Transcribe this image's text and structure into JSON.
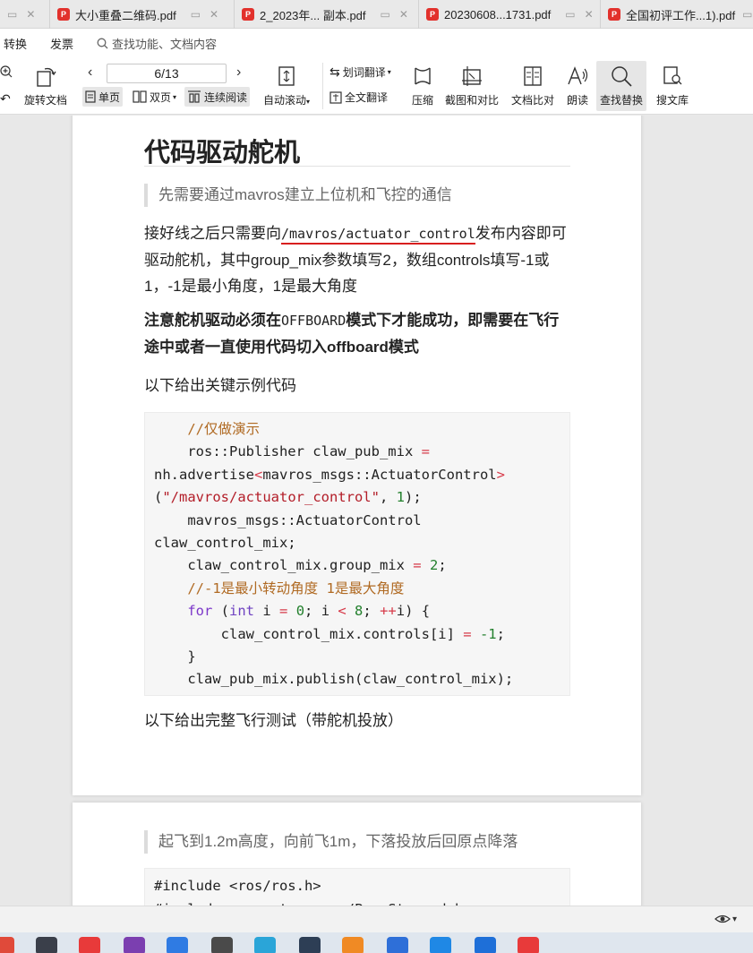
{
  "tabs": [
    {
      "title": ""
    },
    {
      "title": "大小重叠二维码.pdf"
    },
    {
      "title": "2_2023年... 副本.pdf"
    },
    {
      "title": "20230608...1731.pdf"
    },
    {
      "title": "全国初评工作...1).pdf"
    }
  ],
  "menu": {
    "items": [
      "转换",
      "发票"
    ],
    "search_placeholder": "查找功能、文档内容"
  },
  "toolbar": {
    "rotate_label": "旋转文档",
    "page_indicator": "6/13",
    "single_page": "单页",
    "double_page": "双页",
    "continuous": "连续阅读",
    "auto_scroll": "自动滚动",
    "word_translate": "划词翻译",
    "full_translate": "全文翻译",
    "compress": "压缩",
    "screenshot_compare": "截图和对比",
    "doc_compare": "文档比对",
    "read_aloud": "朗读",
    "find_replace": "查找替换",
    "search_library": "搜文库"
  },
  "document": {
    "heading": "代码驱动舵机",
    "quote1": "先需要通过mavros建立上位机和飞控的通信",
    "para1_before": "接好线之后只需要向",
    "para1_code": "/mavros/actuator_control",
    "para1_after": "发布内容即可驱动舵机，其中group_mix参数填写2，数组controls填写-1或1，-1是最小角度，1是最大角度",
    "note_before": "注意舵机驱动必须在",
    "note_code": "OFFBOARD",
    "note_after": "模式下才能成功，即需要在飞行途中或者一直使用代码切入offboard模式",
    "example_intro": "以下给出关键示例代码",
    "code_lines": {
      "l1": "//仅做演示",
      "l2a": "ros::Publisher claw_pub_mix ",
      "l2b": "=",
      "l3a": "nh.advertise",
      "l3b": "<",
      "l3c": "mavros_msgs::ActuatorControl",
      "l3d": ">",
      "l4a": "(",
      "l4b": "\"/mavros/actuator_control\"",
      "l4c": ", ",
      "l4d": "1",
      "l4e": ");",
      "l5": "mavros_msgs::ActuatorControl",
      "l6": "claw_control_mix;",
      "l7a": "claw_control_mix.group_mix ",
      "l7b": "=",
      "l7c": " ",
      "l7d": "2",
      "l7e": ";",
      "l8": "//-1是最小转动角度 1是最大角度",
      "l9a": "for",
      "l9b": " (",
      "l9c": "int",
      "l9d": " i ",
      "l9e": "=",
      "l9f": " ",
      "l9g": "0",
      "l9h": "; i ",
      "l9i": "<",
      "l9j": " ",
      "l9k": "8",
      "l9l": "; ",
      "l9m": "++",
      "l9n": "i) {",
      "l10a": "claw_control_mix.controls[i] ",
      "l10b": "=",
      "l10c": " ",
      "l10d": "-1",
      "l10e": ";",
      "l11": "}",
      "l12": "claw_pub_mix.publish(claw_control_mix);"
    },
    "full_test_intro": "以下给出完整飞行测试（带舵机投放）",
    "quote2": "起飞到1.2m高度，向前飞1m，下落投放后回原点降落",
    "code2_line1": "#include <ros/ros.h>",
    "code2_line2": "#include <geometry_msgs/PoseStamped.h>"
  },
  "colors": {
    "accent_red": "#d81f1f",
    "pdf_icon": "#e2312c",
    "comment": "#b06a23",
    "keyword": "#7b36c9",
    "string": "#b31d28",
    "number": "#23802d"
  }
}
